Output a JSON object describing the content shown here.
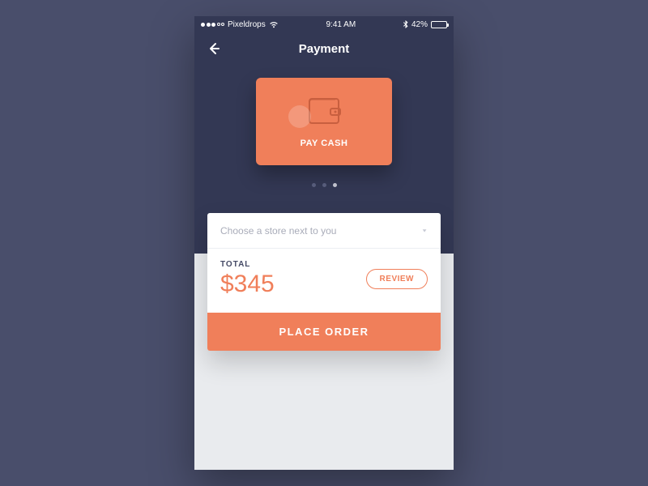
{
  "status": {
    "carrier": "Pixeldrops",
    "time": "9:41 AM",
    "battery": "42%"
  },
  "nav": {
    "title": "Payment"
  },
  "payment_card": {
    "label": "PAY CASH"
  },
  "pager": {
    "count": 3,
    "active_index": 2
  },
  "select": {
    "placeholder": "Choose a store next to you"
  },
  "total": {
    "label": "TOTAL",
    "amount": "$345"
  },
  "buttons": {
    "review": "REVIEW",
    "place_order": "PLACE ORDER"
  }
}
